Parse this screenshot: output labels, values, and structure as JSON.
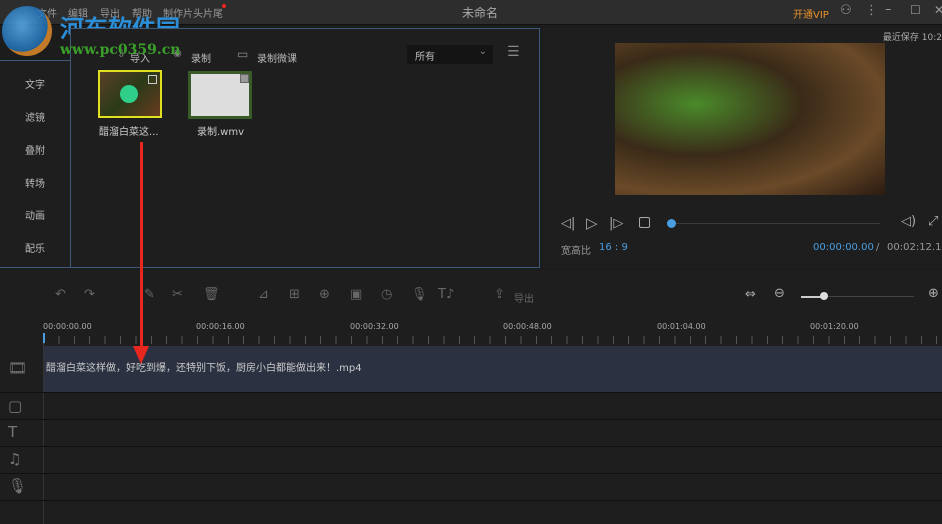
{
  "window": {
    "title": "未命名",
    "vip": "开通VIP",
    "last_saved": "最近保存 10:2"
  },
  "menu": [
    "文件",
    "编辑",
    "导出",
    "帮助",
    "制作片头片尾"
  ],
  "watermark": {
    "name": "河东软件园",
    "url": "www.pc0359.cn"
  },
  "media_toolbar": {
    "import": "导入",
    "record": "录制",
    "record_course": "录制微课",
    "filter": "所有"
  },
  "side_tabs": [
    "文字",
    "滤镜",
    "叠附",
    "转场",
    "动画",
    "配乐"
  ],
  "media_items": [
    {
      "name": "醋溜白菜这...",
      "selected": true
    },
    {
      "name": "录制.wmv",
      "selected": false
    }
  ],
  "preview": {
    "aspect_label": "宽高比",
    "aspect": "16 : 9",
    "current_time": "00:00:00.00",
    "separator": "/",
    "total_time": "00:02:12.10",
    "progress": 0
  },
  "timeline": {
    "export": "导出",
    "zoom_level": 0.2,
    "ruler": [
      "00:00:00.00",
      "00:00:16.00",
      "00:00:32.00",
      "00:00:48.00",
      "00:01:04.00",
      "00:01:20.00"
    ],
    "clip": "醋溜白菜这样做，好吃到爆，还特别下饭，厨房小白都能做出来！.mp4"
  },
  "colors": {
    "accent": "#4a9de0",
    "vip": "#e8902a",
    "selected": "#e0e020",
    "arrow": "#e8281e"
  }
}
